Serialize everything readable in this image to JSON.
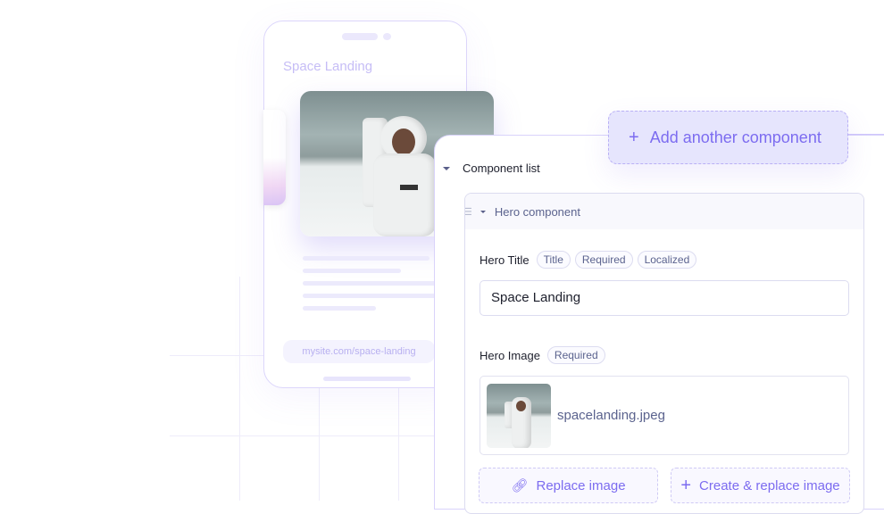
{
  "preview": {
    "title": "Space Landing",
    "url": "mysite.com/space-landing"
  },
  "add_component": {
    "icon": "plus-icon",
    "label": "Add another component"
  },
  "component_list": {
    "label": "Component list",
    "hero": {
      "label": "Hero component",
      "title_field": {
        "label": "Hero Title",
        "tags": [
          "Title",
          "Required",
          "Localized"
        ],
        "value": "Space Landing"
      },
      "image_field": {
        "label": "Hero Image",
        "tags": [
          "Required"
        ],
        "filename": "spacelanding.jpeg"
      },
      "replace_label": "Replace image",
      "create_replace_label": "Create & replace image"
    }
  },
  "colors": {
    "accent": "#7c6cf0",
    "accent_bg": "#e6e5fd",
    "muted_text": "#5b638e"
  }
}
